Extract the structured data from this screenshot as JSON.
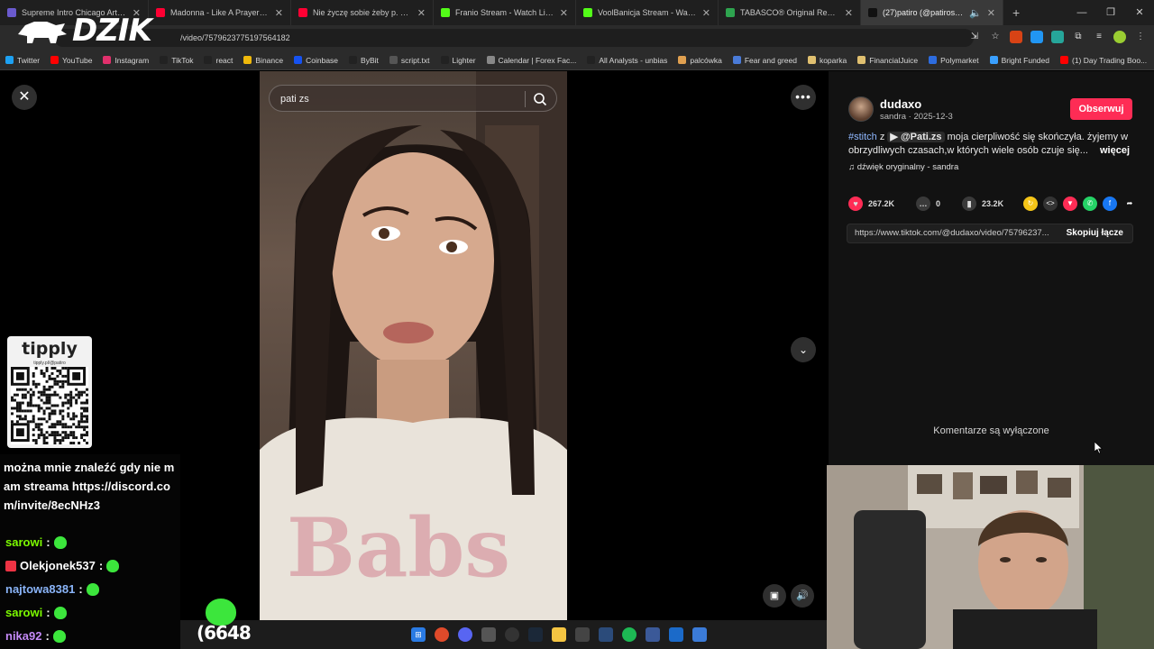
{
  "browser": {
    "tabs": [
      {
        "title": "Supreme Intro Chicago Art Vinyl",
        "color": "#6a5acd",
        "active": false
      },
      {
        "title": "Madonna - Like A Prayer (Offic",
        "color": "#ff0033",
        "active": false
      },
      {
        "title": "Nie życzę sobie żeby p. mnie n",
        "color": "#ff0033",
        "active": false
      },
      {
        "title": "Franio Stream - Watch Live on",
        "color": "#53fc18",
        "active": false
      },
      {
        "title": "VoolBanicja Stream - Watch Li",
        "color": "#53fc18",
        "active": false
      },
      {
        "title": "TABASCO® Original Red Sauce",
        "color": "#2ea44f",
        "active": false
      },
      {
        "title": "(27)patiro (@patiroshoty)",
        "color": "#111111",
        "active": true
      }
    ],
    "new_tab": "+",
    "url": "/video/7579623775197564182",
    "bookmarks": [
      {
        "label": "Twitter",
        "color": "#1da1f2"
      },
      {
        "label": "YouTube",
        "color": "#ff0000"
      },
      {
        "label": "Instagram",
        "color": "#e1306c"
      },
      {
        "label": "TikTok",
        "color": "#222222"
      },
      {
        "label": "react",
        "color": "#222222"
      },
      {
        "label": "Binance",
        "color": "#f0b90b"
      },
      {
        "label": "Coinbase",
        "color": "#1652f0"
      },
      {
        "label": "ByBit",
        "color": "#222222"
      },
      {
        "label": "script.txt",
        "color": "#555555"
      },
      {
        "label": "Lighter",
        "color": "#222222"
      },
      {
        "label": "Calendar | Forex Fac...",
        "color": "#888888"
      },
      {
        "label": "All Analysts - unbias",
        "color": "#222222"
      },
      {
        "label": "palcówka",
        "color": "#e0a050"
      },
      {
        "label": "Fear and greed",
        "color": "#4a7bd8"
      },
      {
        "label": "koparka",
        "color": "#e0c070"
      },
      {
        "label": "FinancialJuice",
        "color": "#e0c070"
      },
      {
        "label": "Polymarket",
        "color": "#2d6cdf"
      },
      {
        "label": "Bright Funded",
        "color": "#3aa0ff"
      },
      {
        "label": "(1) Day Trading Boo...",
        "color": "#ff0000"
      }
    ]
  },
  "overlay": {
    "logo_text": "DZIK"
  },
  "search": {
    "query": "pati zs"
  },
  "post": {
    "username": "dudaxo",
    "nickname_date": "sandra · 2025-12-3",
    "follow_label": "Obserwuj",
    "hashtag": "#stitch",
    "z_word": "z",
    "mention": "@Pati.zs",
    "desc_text": "moja cierpliwość się skończyła. żyjemy w obrzydliwych czasach,w których wiele osób czuje się...",
    "more_label": "więcej",
    "sound": "dźwięk oryginalny - sandra",
    "likes": "267.2K",
    "comments": "0",
    "saves": "23.2K",
    "link": "https://www.tiktok.com/@dudaxo/video/75796237...",
    "copy_label": "Skopiuj łącze",
    "comments_off": "Komentarze są wyłączone"
  },
  "tipply": {
    "title": "tipply",
    "url": "tipply.pl/@patiro"
  },
  "chat": {
    "pinned": "można mnie znaleźć gdy nie mam streama https://discord.com/invite/8ecNHz3",
    "messages": [
      {
        "user": "sarowi",
        "color": "#7CFC00"
      },
      {
        "user": "Olekjonek537",
        "color": "#ffffff"
      },
      {
        "user": "najtowa8381",
        "color": "#8ab4f8"
      },
      {
        "user": "sarowi",
        "color": "#7CFC00"
      },
      {
        "user": "nika92",
        "color": "#c58af9"
      }
    ]
  },
  "counter": "(6648"
}
